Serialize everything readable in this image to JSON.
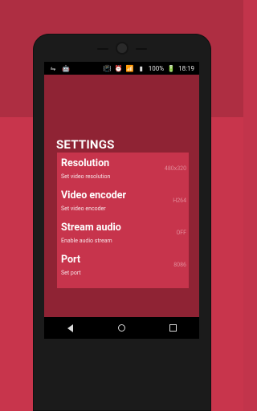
{
  "status_bar": {
    "battery_text": "100%",
    "time": "18:19",
    "icons": [
      "usb-icon",
      "android-debug-icon",
      "vibrate-icon",
      "alarm-icon",
      "wifi-icon",
      "signal-icon",
      "battery-icon"
    ]
  },
  "app": {
    "title": "SETTINGS",
    "items": [
      {
        "label": "Resolution",
        "subtitle": "Set video resolution",
        "value": "480x320"
      },
      {
        "label": "Video encoder",
        "subtitle": "Set video encoder",
        "value": "H264"
      },
      {
        "label": "Stream audio",
        "subtitle": "Enable audio stream",
        "value": "OFF"
      },
      {
        "label": "Port",
        "subtitle": "Set port",
        "value": "8086"
      }
    ]
  },
  "nav": {
    "back_icon": "back-triangle-icon",
    "home_icon": "home-circle-icon",
    "recents_icon": "recents-square-icon"
  },
  "colors": {
    "background_top": "#ae2e42",
    "background_bottom": "#c8354c",
    "screen_bg": "#8f2334",
    "card_bg": "#c7344c",
    "value_text": "#e28b99"
  }
}
